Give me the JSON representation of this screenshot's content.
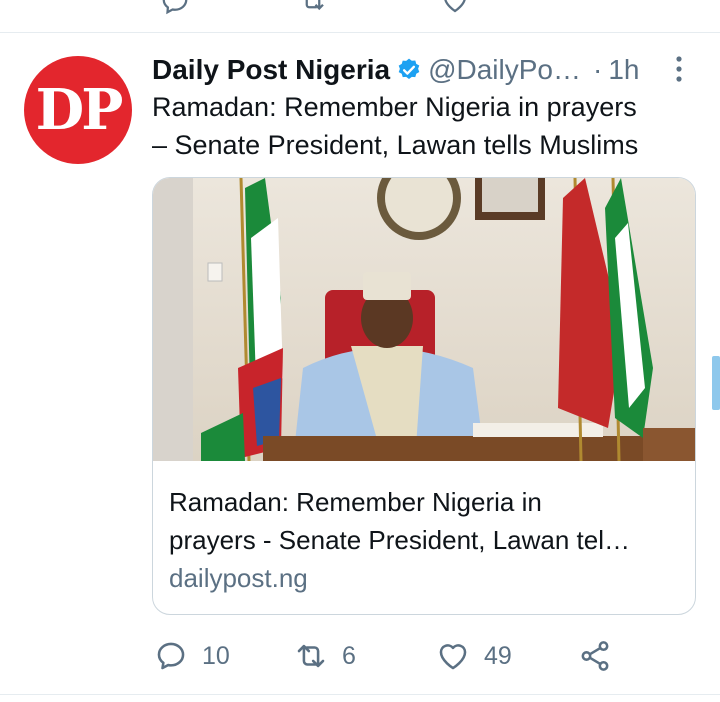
{
  "tweet": {
    "avatar_text": "DP",
    "display_name": "Daily Post Nigeria",
    "handle": "@DailyPo…",
    "separator": "·",
    "time": "1h",
    "text_line1": "Ramadan: Remember Nigeria in prayers",
    "text_line2": "– Senate President, Lawan tells Muslims",
    "card": {
      "title_line1": "Ramadan: Remember Nigeria in",
      "title_line2": "prayers - Senate President, Lawan tel…",
      "domain": "dailypost.ng"
    },
    "actions": {
      "replies": "10",
      "retweets": "6",
      "likes": "49"
    }
  },
  "colors": {
    "accent": "#1da1f2",
    "avatar_bg": "#e3262d",
    "secondary_text": "#5b7083"
  },
  "icons": [
    "reply-icon",
    "retweet-icon",
    "like-icon",
    "share-icon",
    "verified-icon",
    "more-icon"
  ]
}
